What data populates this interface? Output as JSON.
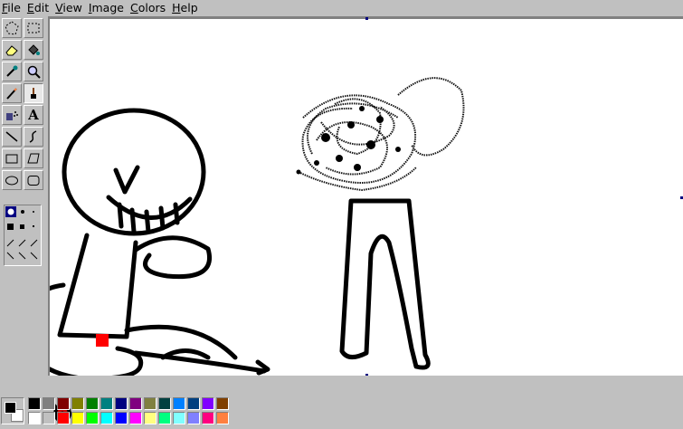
{
  "menu": [
    {
      "id": "file",
      "label": "File"
    },
    {
      "id": "edit",
      "label": "Edit"
    },
    {
      "id": "view",
      "label": "View"
    },
    {
      "id": "image",
      "label": "Image"
    },
    {
      "id": "colors",
      "label": "Colors"
    },
    {
      "id": "help",
      "label": "Help"
    }
  ],
  "tools": [
    {
      "name": "free-select-icon",
      "active": false
    },
    {
      "name": "rect-select-icon",
      "active": false
    },
    {
      "name": "eraser-icon",
      "active": false
    },
    {
      "name": "fill-bucket-icon",
      "active": false
    },
    {
      "name": "color-picker-icon",
      "active": false
    },
    {
      "name": "magnifier-icon",
      "active": false
    },
    {
      "name": "pencil-icon",
      "active": true
    },
    {
      "name": "brush-icon",
      "active": false
    },
    {
      "name": "airbrush-icon",
      "active": false
    },
    {
      "name": "text-icon",
      "active": false
    },
    {
      "name": "line-icon",
      "active": false
    },
    {
      "name": "curve-icon",
      "active": false
    },
    {
      "name": "rectangle-icon",
      "active": false
    },
    {
      "name": "polygon-icon",
      "active": false
    },
    {
      "name": "ellipse-icon",
      "active": false
    },
    {
      "name": "rounded-rect-icon",
      "active": false
    }
  ],
  "text_tool_glyph": "A",
  "colors": {
    "foreground": "#000000",
    "background": "#ffffff",
    "palette_top": [
      "#000000",
      "#808080",
      "#800000",
      "#808000",
      "#008000",
      "#008080",
      "#000080",
      "#800080",
      "#808040",
      "#004040",
      "#0080ff",
      "#004080",
      "#8000ff",
      "#804000"
    ],
    "palette_bottom": [
      "#ffffff",
      "#c0c0c0",
      "#ff0000",
      "#ffff00",
      "#00ff00",
      "#00ffff",
      "#0000ff",
      "#ff00ff",
      "#ffff80",
      "#00ff80",
      "#80ffff",
      "#8080ff",
      "#ff0080",
      "#ff8040"
    ]
  }
}
